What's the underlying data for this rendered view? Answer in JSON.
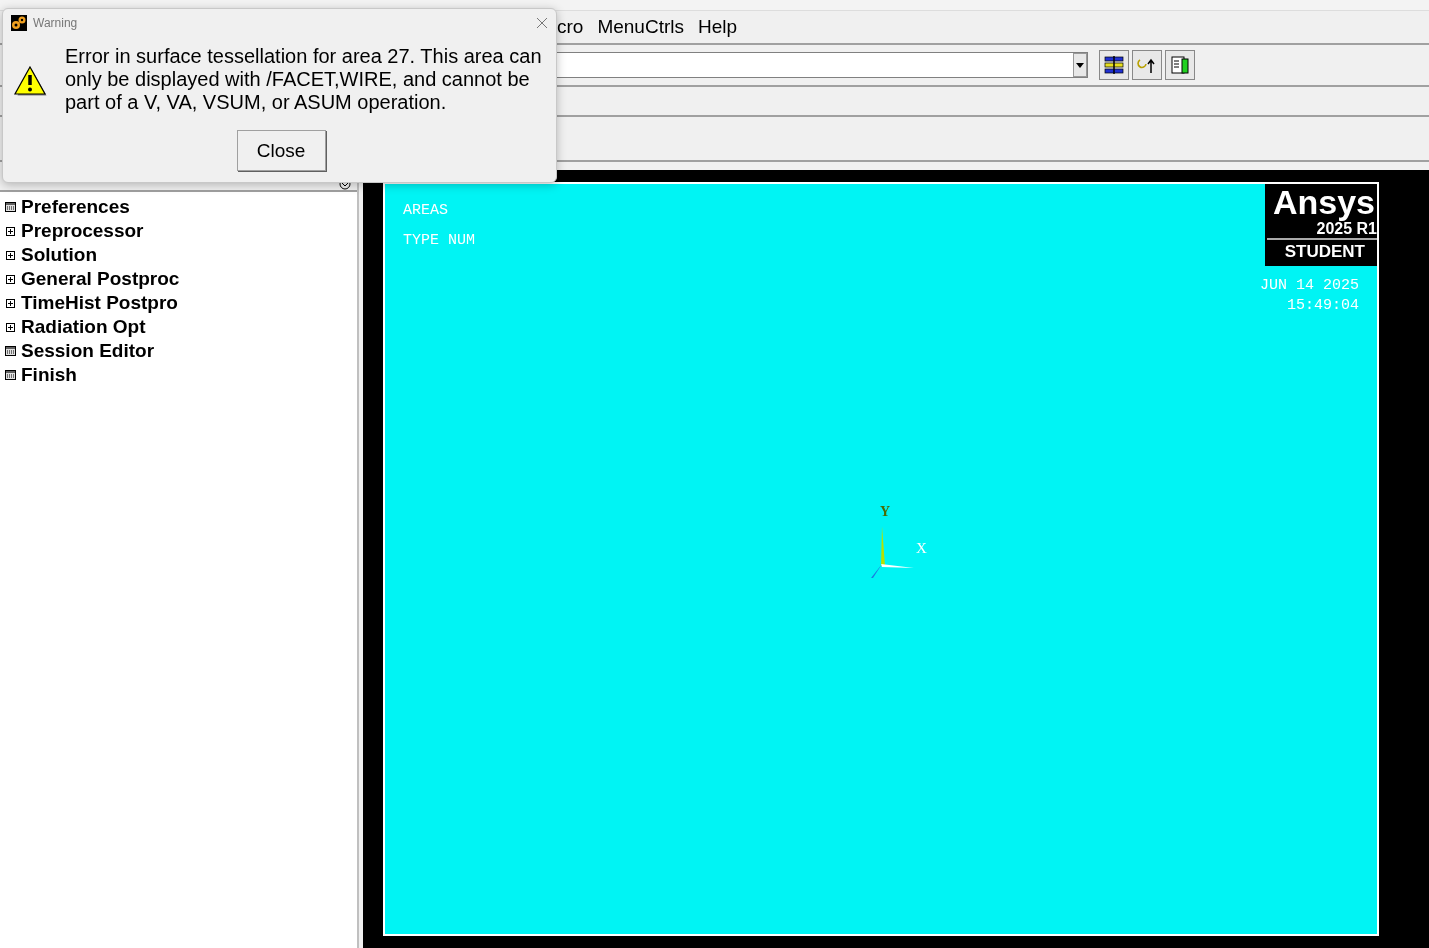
{
  "menu_bar": {
    "items": [
      {
        "label": "cro"
      },
      {
        "label": "MenuCtrls"
      },
      {
        "label": "Help"
      }
    ]
  },
  "main_menu": {
    "items": [
      {
        "label": "Preferences",
        "kind": "command"
      },
      {
        "label": "Preprocessor",
        "kind": "submenu",
        "expanded": false
      },
      {
        "label": "Solution",
        "kind": "submenu",
        "expanded": false
      },
      {
        "label": "General Postproc",
        "kind": "submenu",
        "expanded": false
      },
      {
        "label": "TimeHist Postpro",
        "kind": "submenu",
        "expanded": false
      },
      {
        "label": "Radiation Opt",
        "kind": "submenu",
        "expanded": false
      },
      {
        "label": "Session Editor",
        "kind": "command"
      },
      {
        "label": "Finish",
        "kind": "command"
      }
    ]
  },
  "graphics": {
    "labels": [
      "AREAS",
      "TYPE NUM"
    ],
    "logo": {
      "brand": "Ansys",
      "version": "2025 R1",
      "edition": "STUDENT"
    },
    "date": "JUN 14 2025",
    "time": "15:49:04",
    "axes": {
      "x": "X",
      "y": "Y"
    }
  },
  "dialog": {
    "title": "Warning",
    "message": "Error in surface tessellation for area 27.  This area can only be displayed with /FACET,WIRE, and cannot be part of a V, VA, VSUM, or ASUM operation.",
    "button": "Close"
  }
}
